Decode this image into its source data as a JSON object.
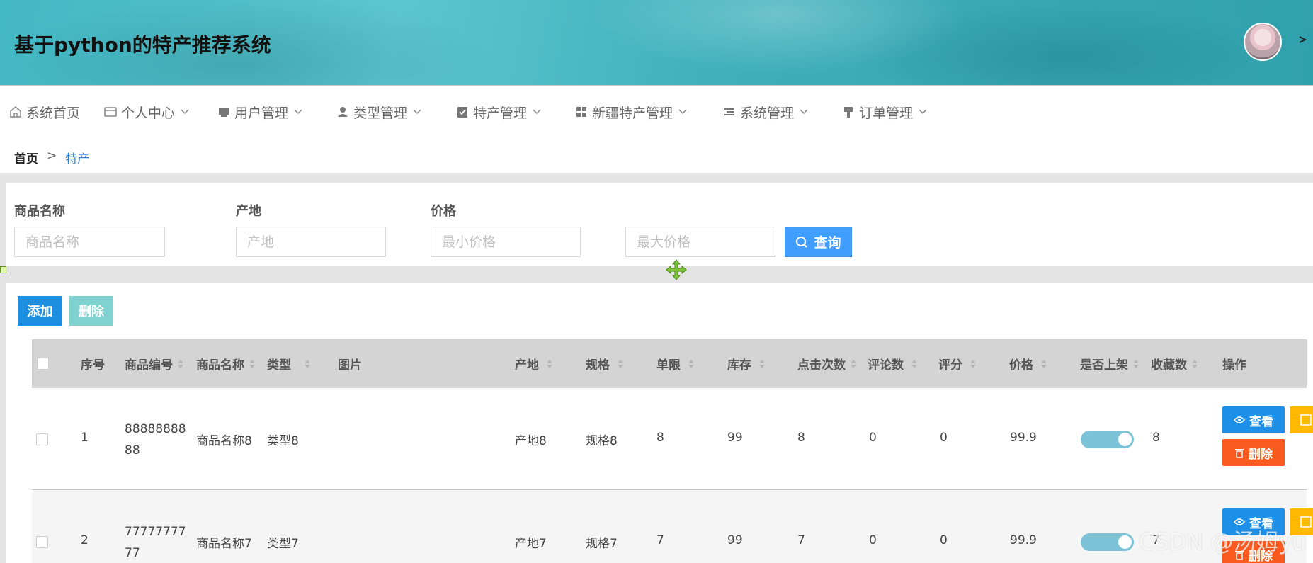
{
  "header": {
    "title": "基于python的特产推荐系统"
  },
  "nav": {
    "items": [
      {
        "label": "系统首页",
        "icon": "home-icon"
      },
      {
        "label": "个人中心",
        "icon": "wallet-icon"
      },
      {
        "label": "用户管理",
        "icon": "monitor-icon"
      },
      {
        "label": "类型管理",
        "icon": "user-icon"
      },
      {
        "label": "特产管理",
        "icon": "clipboard-check-icon"
      },
      {
        "label": "新疆特产管理",
        "icon": "grid-icon"
      },
      {
        "label": "系统管理",
        "icon": "list-icon"
      },
      {
        "label": "订单管理",
        "icon": "brush-icon"
      }
    ]
  },
  "breadcrumb": {
    "home": "首页",
    "separator": ">",
    "current": "特产"
  },
  "search": {
    "name_label": "商品名称",
    "name_placeholder": "商品名称",
    "origin_label": "产地",
    "origin_placeholder": "产地",
    "price_label": "价格",
    "min_price_placeholder": "最小价格",
    "max_price_placeholder": "最大价格",
    "query_label": "查询"
  },
  "toolbar": {
    "add_label": "添加",
    "delete_label": "删除"
  },
  "table": {
    "columns": [
      "序号",
      "商品编号",
      "商品名称",
      "类型",
      "图片",
      "产地",
      "规格",
      "单限",
      "库存",
      "点击次数",
      "评论数",
      "评分",
      "价格",
      "是否上架",
      "收藏数",
      "操作"
    ],
    "rows": [
      {
        "index": "1",
        "code": "8888888888",
        "name": "商品名称8",
        "type": "类型8",
        "origin": "产地8",
        "spec": "规格8",
        "limit": "8",
        "stock": "99",
        "clicks": "8",
        "comments": "0",
        "rating": "0",
        "price": "99.9",
        "on_shelf": true,
        "favorites": "8"
      },
      {
        "index": "2",
        "code": "7777777777",
        "name": "商品名称7",
        "type": "类型7",
        "origin": "产地7",
        "spec": "规格7",
        "limit": "7",
        "stock": "99",
        "clicks": "7",
        "comments": "0",
        "rating": "0",
        "price": "99.9",
        "on_shelf": true,
        "favorites": "7"
      }
    ],
    "view_label": "查看",
    "delete_label": "删除"
  },
  "watermark": "CSDN @汤姆yu",
  "colors": {
    "primary": "#409eff",
    "danger": "#fb5a1e",
    "warning": "#ffba00",
    "header": "#42b8c4"
  }
}
